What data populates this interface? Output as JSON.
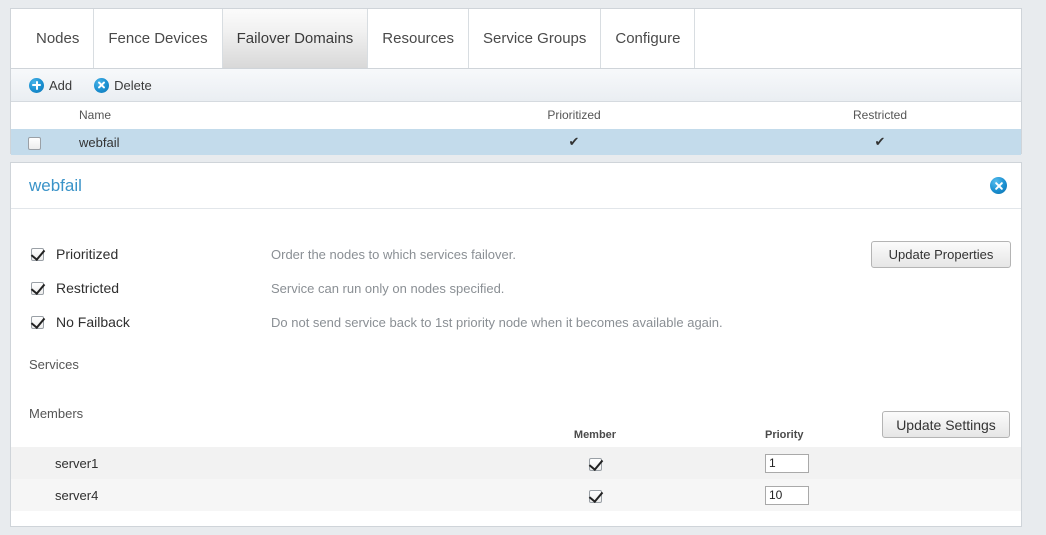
{
  "tabs": [
    {
      "label": "Nodes",
      "active": false
    },
    {
      "label": "Fence Devices",
      "active": false
    },
    {
      "label": "Failover Domains",
      "active": true
    },
    {
      "label": "Resources",
      "active": false
    },
    {
      "label": "Service Groups",
      "active": false
    },
    {
      "label": "Configure",
      "active": false
    }
  ],
  "toolbar": {
    "add_label": "Add",
    "delete_label": "Delete",
    "add_icon": "add-circle-icon",
    "delete_icon": "delete-circle-icon"
  },
  "domains_table": {
    "headers": [
      "Name",
      "Prioritized",
      "Restricted"
    ],
    "rows": [
      {
        "selected": true,
        "checked": false,
        "name": "webfail",
        "prioritized": "✔",
        "restricted": "✔"
      }
    ]
  },
  "detail": {
    "title": "webfail",
    "close_icon": "close-circle-icon",
    "options": [
      {
        "label": "Prioritized",
        "checked": true,
        "description": "Order the nodes to which services failover."
      },
      {
        "label": "Restricted",
        "checked": true,
        "description": "Service can run only on nodes specified."
      },
      {
        "label": "No Failback",
        "checked": true,
        "description": "Do not send service back to 1st priority node when it becomes available again."
      }
    ],
    "update_properties_label": "Update Properties",
    "services_label": "Services",
    "members_label": "Members",
    "update_settings_label": "Update Settings",
    "members_table": {
      "headers": [
        "",
        "Member",
        "Priority"
      ],
      "rows": [
        {
          "name": "server1",
          "member": true,
          "priority": "1"
        },
        {
          "name": "server4",
          "member": true,
          "priority": "10"
        }
      ]
    }
  },
  "colors": {
    "accent_blue": "#1a8fd0",
    "link_blue": "#3a93c8",
    "selected_row": "#c3dbeb",
    "page_bg": "#e8ebee"
  }
}
